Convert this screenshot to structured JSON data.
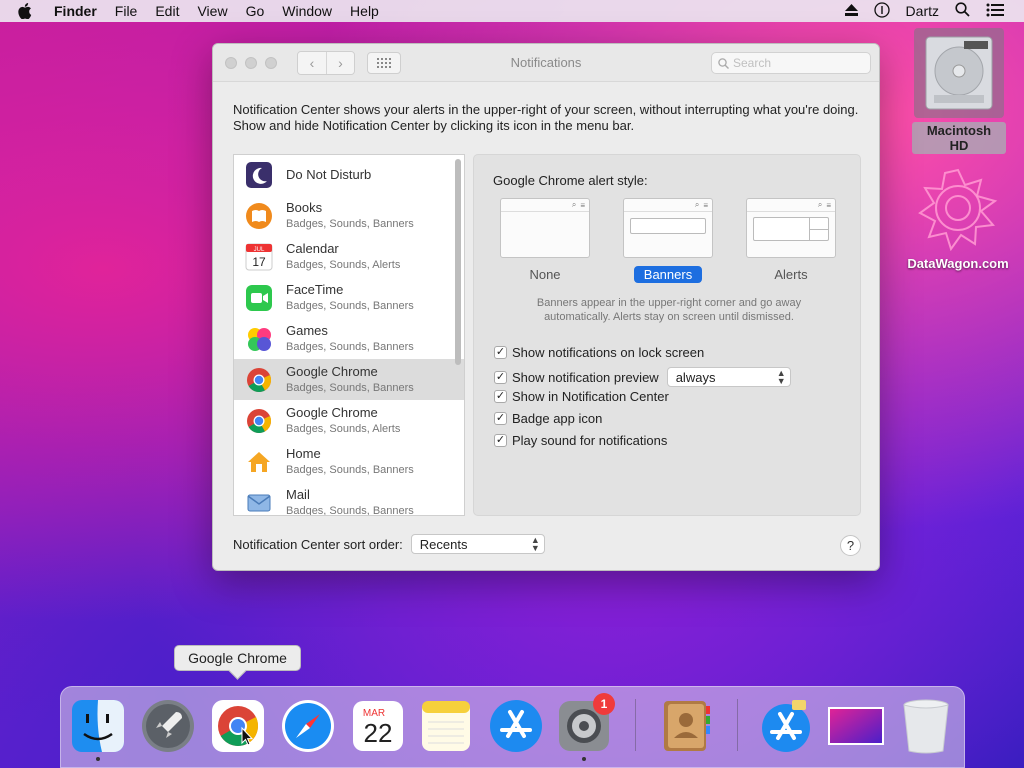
{
  "menubar": {
    "app_name": "Finder",
    "items": [
      "File",
      "Edit",
      "View",
      "Go",
      "Window",
      "Help"
    ],
    "user": "Dartz"
  },
  "desktop": {
    "hd_label": "Macintosh HD",
    "datawagon_label": "DataWagon.com"
  },
  "window": {
    "title": "Notifications",
    "search_placeholder": "Search",
    "description": "Notification Center shows your alerts in the upper-right of your screen, without interrupting what you're doing. Show and hide Notification Center by clicking its icon in the menu bar.",
    "apps": [
      {
        "name": "Do Not Disturb",
        "sub": "",
        "icon": "moon-icon"
      },
      {
        "name": "Books",
        "sub": "Badges, Sounds, Banners",
        "icon": "books-icon"
      },
      {
        "name": "Calendar",
        "sub": "Badges, Sounds, Alerts",
        "icon": "calendar-icon"
      },
      {
        "name": "FaceTime",
        "sub": "Badges, Sounds, Banners",
        "icon": "facetime-icon"
      },
      {
        "name": "Games",
        "sub": "Badges, Sounds, Banners",
        "icon": "games-icon"
      },
      {
        "name": "Google Chrome",
        "sub": "Badges, Sounds, Banners",
        "icon": "chrome-icon",
        "selected": true
      },
      {
        "name": "Google Chrome",
        "sub": "Badges, Sounds, Alerts",
        "icon": "chrome-icon"
      },
      {
        "name": "Home",
        "sub": "Badges, Sounds, Banners",
        "icon": "home-icon"
      },
      {
        "name": "Mail",
        "sub": "Badges, Sounds, Banners",
        "icon": "mail-icon"
      }
    ],
    "alert_style_label": "Google Chrome alert style:",
    "styles": {
      "none": "None",
      "banners": "Banners",
      "alerts": "Alerts",
      "selected": "Banners"
    },
    "help_text": "Banners appear in the upper-right corner and go away automatically. Alerts stay on screen until dismissed.",
    "options": {
      "lock_screen": "Show notifications on lock screen",
      "preview": "Show notification preview",
      "preview_value": "always",
      "notification_center": "Show in Notification Center",
      "badge": "Badge app icon",
      "sound": "Play sound for notifications"
    },
    "sort_label": "Notification Center sort order:",
    "sort_value": "Recents",
    "help_button": "?"
  },
  "calendar_icon": {
    "month": "JUL",
    "day": "17"
  },
  "dock": {
    "tooltip": "Google Chrome",
    "calendar_month": "MAR",
    "calendar_day": "22",
    "sys_prefs_badge": "1"
  },
  "colors": {
    "accent": "#1d6ee0",
    "badge": "#f03b3b"
  }
}
